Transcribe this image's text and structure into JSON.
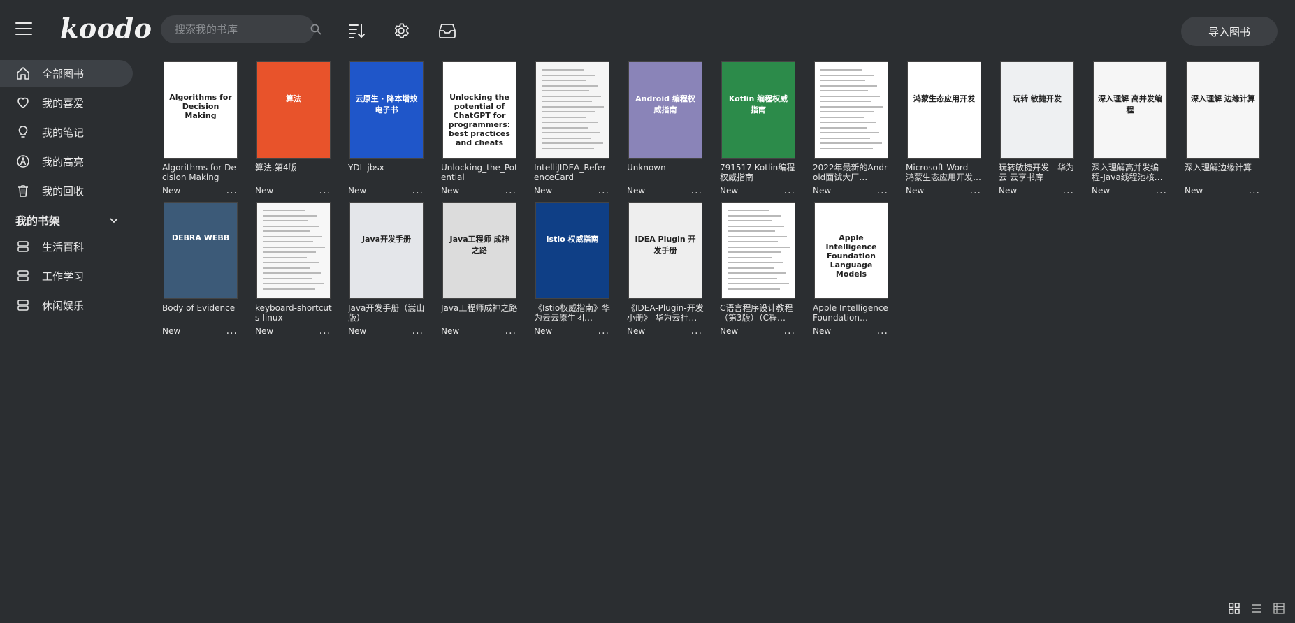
{
  "app": {
    "logo": "koodo"
  },
  "search": {
    "placeholder": "搜索我的书库"
  },
  "header": {
    "import_label": "导入图书"
  },
  "sidebar": {
    "items": [
      {
        "label": "全部图书",
        "icon": "home-icon",
        "active": true
      },
      {
        "label": "我的喜爱",
        "icon": "heart-icon"
      },
      {
        "label": "我的笔记",
        "icon": "lightbulb-icon"
      },
      {
        "label": "我的高亮",
        "icon": "highlighter-icon"
      },
      {
        "label": "我的回收",
        "icon": "trash-icon"
      }
    ],
    "shelf_header": "我的书架",
    "shelves": [
      {
        "label": "生活百科",
        "icon": "shelf-icon"
      },
      {
        "label": "工作学习",
        "icon": "shelf-icon"
      },
      {
        "label": "休闲娱乐",
        "icon": "shelf-icon"
      }
    ]
  },
  "books": [
    {
      "title": "Algorithms for Decision Making",
      "status": "New",
      "more": "...",
      "cover_bg": "#ffffff",
      "cover_text": "Algorithms for Decision Making"
    },
    {
      "title": "算法.第4版",
      "status": "New",
      "more": "...",
      "cover_bg": "#e8532b",
      "cover_text": "算法"
    },
    {
      "title": "YDL-jbsx",
      "status": "New",
      "more": "...",
      "cover_bg": "#1f56c9",
      "cover_text": "云原生 · 降本增效电子书"
    },
    {
      "title": "Unlocking_the_Potential",
      "status": "New",
      "more": "...",
      "cover_bg": "#ffffff",
      "cover_text": "Unlocking the potential of ChatGPT for programmers: best practices and cheats"
    },
    {
      "title": "IntelliJIDEA_ReferenceCard",
      "status": "New",
      "more": "...",
      "cover_bg": "#f5f5f5",
      "cover_text": ""
    },
    {
      "title": "Unknown",
      "status": "New",
      "more": "...",
      "cover_bg": "#8a84b8",
      "cover_text": "Android 编程权威指南"
    },
    {
      "title": "791517 Kotlin编程权威指南",
      "status": "New",
      "more": "...",
      "cover_bg": "#2c8b4a",
      "cover_text": "Kotlin 编程权威指南"
    },
    {
      "title": "2022年最新的Android面试大厂…",
      "status": "New",
      "more": "...",
      "cover_bg": "#ffffff",
      "cover_text": ""
    },
    {
      "title": "Microsoft Word - 鸿蒙生态应用开发…",
      "status": "New",
      "more": "...",
      "cover_bg": "#ffffff",
      "cover_text": "鸿蒙生态应用开发"
    },
    {
      "title": "玩转敏捷开发 - 华为云 云享书库",
      "status": "New",
      "more": "...",
      "cover_bg": "#eef0f2",
      "cover_text": "玩转 敏捷开发"
    },
    {
      "title": "深入理解高并发编程-Java线程池核…",
      "status": "New",
      "more": "...",
      "cover_bg": "#f6f6f6",
      "cover_text": "深入理解 高并发编程"
    },
    {
      "title": "深入理解边缘计算",
      "status": "New",
      "more": "...",
      "cover_bg": "#f6f6f6",
      "cover_text": "深入理解 边缘计算"
    },
    {
      "title": "Body of Evidence",
      "status": "New",
      "more": "...",
      "cover_bg": "#3c5a78",
      "cover_text": "DEBRA WEBB"
    },
    {
      "title": "keyboard-shortcuts-linux",
      "status": "New",
      "more": "...",
      "cover_bg": "#f7f7f7",
      "cover_text": ""
    },
    {
      "title": "Java开发手册（嵩山版）",
      "status": "New",
      "more": "...",
      "cover_bg": "#e4e6ea",
      "cover_text": "Java开发手册"
    },
    {
      "title": "Java工程师成神之路",
      "status": "New",
      "more": "...",
      "cover_bg": "#dcdcdc",
      "cover_text": "Java工程师 成神之路"
    },
    {
      "title": "《Istio权威指南》华为云云原生团…",
      "status": "New",
      "more": "...",
      "cover_bg": "#0f3f86",
      "cover_text": "Istio 权威指南"
    },
    {
      "title": "《IDEA-Plugin-开发小册》-华为云社…",
      "status": "New",
      "more": "...",
      "cover_bg": "#eeeeee",
      "cover_text": "IDEA Plugin 开发手册"
    },
    {
      "title": "C语言程序设计教程（第3版）（C程…",
      "status": "New",
      "more": "...",
      "cover_bg": "#ffffff",
      "cover_text": ""
    },
    {
      "title": "Apple Intelligence Foundation…",
      "status": "New",
      "more": "...",
      "cover_bg": "#ffffff",
      "cover_text": "Apple Intelligence Foundation Language Models"
    }
  ]
}
